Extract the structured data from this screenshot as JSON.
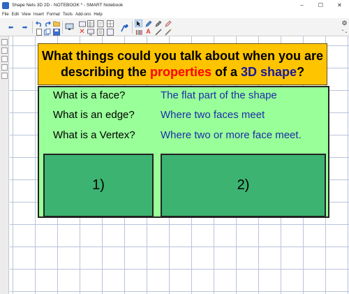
{
  "window": {
    "title": "Shape Nets 3D 2D - NOTEBOOK * - SMART Notebook",
    "minimize": "–",
    "maximize": "☐",
    "close": "✕"
  },
  "menu": {
    "items": [
      "File",
      "Edit",
      "View",
      "Insert",
      "Format",
      "Tools",
      "Add-ons",
      "Help"
    ]
  },
  "toolbar": {
    "back": "⬅",
    "forward": "➡",
    "settings": "⚙",
    "chevrons": "⌃⌄"
  },
  "slide": {
    "question_part1": "What things could you talk about when you are describing the ",
    "question_highlight": "properties",
    "question_mid": " of a ",
    "question_highlight2": "3D shape",
    "question_end": "?",
    "rows": [
      {
        "q": "What is a face?",
        "a": "The flat part of the shape"
      },
      {
        "q": "What is an edge?",
        "a": "Where two faces meet"
      },
      {
        "q": "What is a Vertex?",
        "a": "Where two or more face meet."
      }
    ],
    "box1": "1)",
    "box2": "2)"
  },
  "colors": {
    "question_bg": "#ffc400",
    "panel_bg": "#99ff99",
    "box_bg": "#3cb371",
    "highlight_red": "#ff0000",
    "highlight_blue": "#1a1a9e",
    "answer_text": "#1a2ea8"
  }
}
